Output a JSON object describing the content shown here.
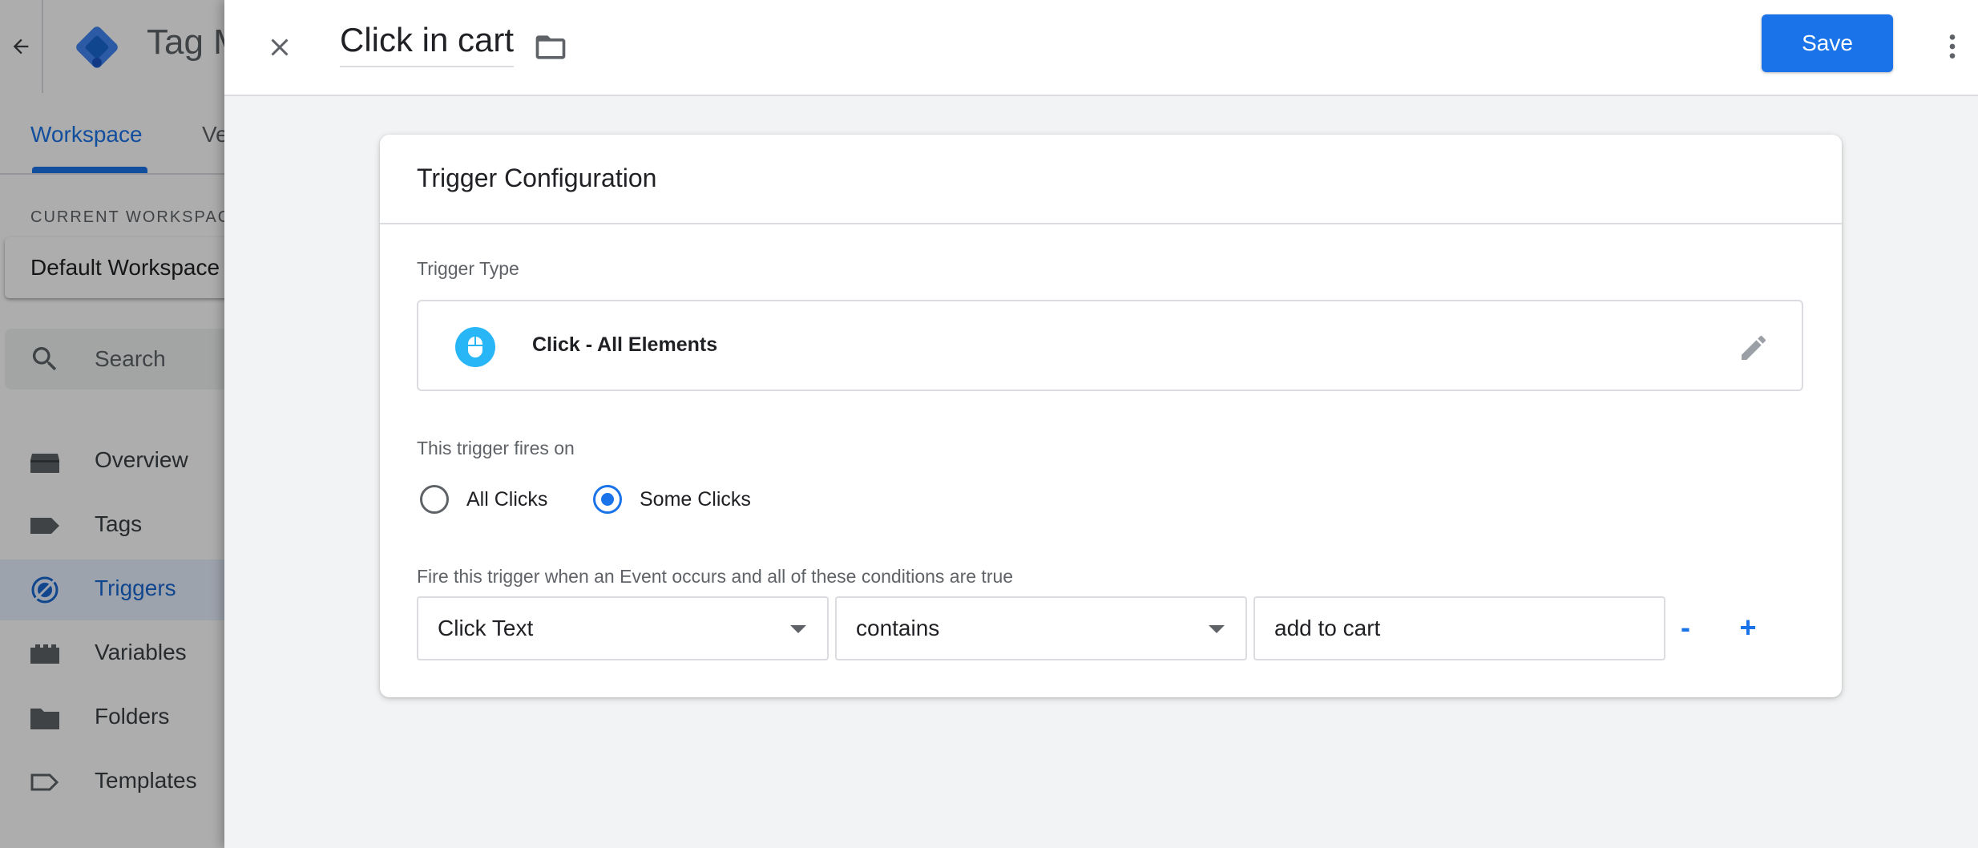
{
  "background_app": {
    "title": "Tag M",
    "tabs": [
      {
        "label": "Workspace",
        "active": true
      },
      {
        "label": "Ve",
        "active": false
      }
    ],
    "current_workspace_label": "CURRENT WORKSPAC",
    "workspace_name": "Default Workspace",
    "search_placeholder": "Search",
    "nav_items": [
      {
        "label": "Overview",
        "icon": "overview-icon"
      },
      {
        "label": "Tags",
        "icon": "tag-icon"
      },
      {
        "label": "Triggers",
        "icon": "trigger-icon",
        "active": true
      },
      {
        "label": "Variables",
        "icon": "variables-icon"
      },
      {
        "label": "Folders",
        "icon": "folder-icon"
      },
      {
        "label": "Templates",
        "icon": "templates-icon"
      }
    ]
  },
  "drawer": {
    "trigger_name": "Click in cart",
    "save_label": "Save",
    "card": {
      "title": "Trigger Configuration",
      "trigger_type_label": "Trigger Type",
      "trigger_type_name": "Click - All Elements",
      "fires_on_label": "This trigger fires on",
      "fires_on_options": [
        {
          "label": "All Clicks",
          "selected": false
        },
        {
          "label": "Some Clicks",
          "selected": true
        }
      ],
      "condition_label": "Fire this trigger when an Event occurs and all of these conditions are true",
      "condition": {
        "variable": "Click Text",
        "operator": "contains",
        "value": "add to cart"
      },
      "remove_label": "-",
      "add_label": "+"
    }
  },
  "colors": {
    "accent": "#1a73e8",
    "mouse_icon": "#29b6f6"
  }
}
